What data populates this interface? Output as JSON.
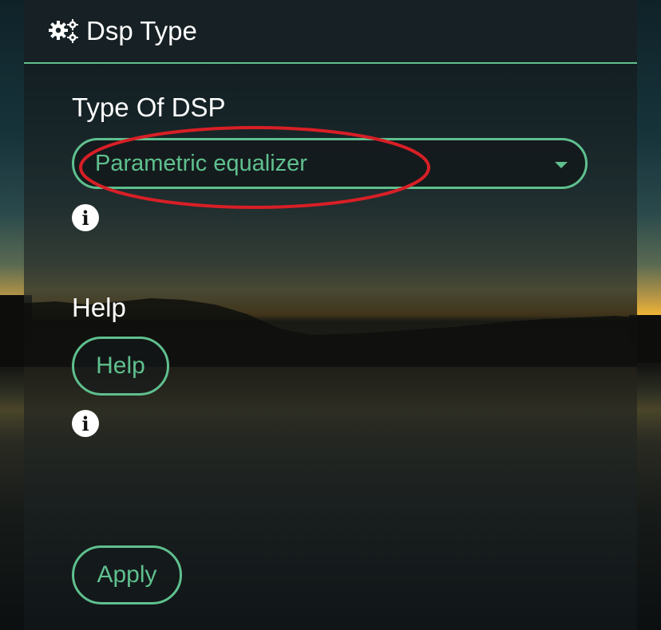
{
  "header": {
    "icon": "gears-icon",
    "title": "Dsp Type"
  },
  "dsp_type": {
    "label": "Type Of DSP",
    "selected": "Parametric equalizer",
    "info_icon": "info-icon"
  },
  "help": {
    "label": "Help",
    "button_label": "Help",
    "info_icon": "info-icon"
  },
  "actions": {
    "apply_label": "Apply"
  },
  "colors": {
    "accent": "#5fc08e",
    "header_bg": "#172125",
    "annotation": "#d81f26"
  }
}
